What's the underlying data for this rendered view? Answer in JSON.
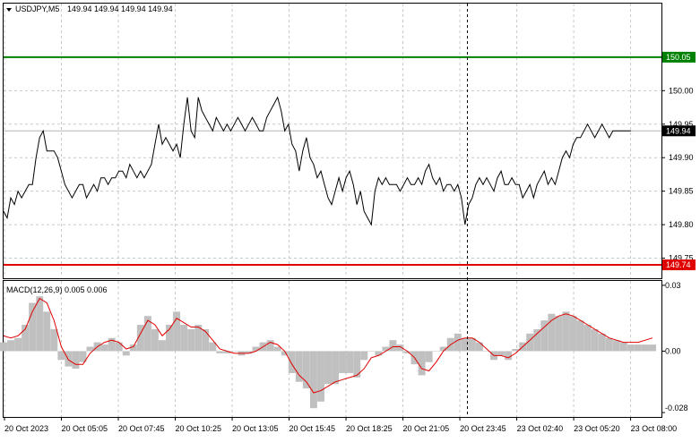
{
  "header": {
    "symbol": "USDJPY,M5",
    "ohlc": "149.94 149.94 149.94 149.94",
    "menu_icon": "triangle-down-icon"
  },
  "colors": {
    "price_line": "#000000",
    "resistance": "#008000",
    "support": "#e00000",
    "macd_hist": "#c0c0c0",
    "macd_signal": "#e00000",
    "grid": "#c8c8c8",
    "current_price_line": "#b4b4b4",
    "current_tag_bg": "#000000"
  },
  "chart_data": [
    {
      "type": "line",
      "name": "price",
      "ylim": [
        149.72,
        150.13
      ],
      "y_ticks": [
        "150.00",
        "149.95",
        "149.90",
        "149.85",
        "149.80",
        "149.75"
      ],
      "x": [
        0,
        2,
        4,
        6,
        8,
        10,
        12,
        14,
        16,
        18,
        20,
        22,
        24,
        26,
        28,
        30,
        32,
        34,
        36,
        38,
        40,
        42,
        44,
        46,
        48,
        50,
        52,
        54,
        56,
        58,
        60,
        62,
        64,
        66,
        68,
        70,
        72,
        74,
        76,
        78,
        80,
        82,
        84,
        86,
        88,
        90,
        92,
        94,
        96,
        98,
        100,
        102,
        104,
        106,
        108,
        110,
        112,
        114,
        116,
        118,
        120,
        122,
        124,
        126,
        128,
        130,
        132,
        134,
        136,
        138,
        140,
        142,
        144,
        146,
        148,
        150,
        152,
        154,
        156,
        158,
        160,
        162,
        164,
        166,
        168,
        170,
        172,
        174,
        176,
        178,
        180,
        182,
        184,
        186,
        188,
        190,
        192,
        194,
        196,
        198,
        200,
        202,
        204,
        206,
        208,
        210,
        212,
        214,
        216,
        218,
        220,
        222,
        224,
        226,
        228,
        230,
        232,
        234,
        236,
        238,
        240,
        242,
        244,
        246,
        248,
        250,
        252,
        254,
        256,
        258,
        260,
        262,
        264,
        266,
        268,
        270,
        272,
        274,
        276,
        278,
        280,
        282,
        284,
        286,
        288,
        290,
        292,
        294,
        296,
        298,
        300,
        302,
        304,
        306,
        308,
        310,
        312,
        314,
        316,
        318,
        320,
        322,
        324,
        326,
        328,
        330,
        332,
        334,
        336,
        338,
        340,
        342,
        344,
        346,
        348,
        350,
        352,
        354,
        356,
        358,
        360
      ],
      "values": [
        149.82,
        149.81,
        149.84,
        149.83,
        149.85,
        149.84,
        149.85,
        149.86,
        149.86,
        149.9,
        149.93,
        149.94,
        149.91,
        149.91,
        149.91,
        149.9,
        149.88,
        149.86,
        149.85,
        149.84,
        149.85,
        149.86,
        149.86,
        149.84,
        149.85,
        149.86,
        149.85,
        149.87,
        149.87,
        149.86,
        149.87,
        149.87,
        149.88,
        149.88,
        149.87,
        149.89,
        149.88,
        149.87,
        149.88,
        149.87,
        149.88,
        149.89,
        149.92,
        149.95,
        149.92,
        149.93,
        149.92,
        149.91,
        149.92,
        149.9,
        149.95,
        149.99,
        149.94,
        149.93,
        149.99,
        149.97,
        149.96,
        149.95,
        149.94,
        149.96,
        149.95,
        149.94,
        149.95,
        149.94,
        149.95,
        149.96,
        149.95,
        149.94,
        149.95,
        149.96,
        149.95,
        149.94,
        149.94,
        149.96,
        149.97,
        149.98,
        149.99,
        149.97,
        149.94,
        149.95,
        149.92,
        149.91,
        149.88,
        149.91,
        149.93,
        149.9,
        149.89,
        149.87,
        149.88,
        149.86,
        149.84,
        149.83,
        149.85,
        149.87,
        149.85,
        149.87,
        149.88,
        149.86,
        149.83,
        149.85,
        149.82,
        149.81,
        149.8,
        149.85,
        149.87,
        149.86,
        149.87,
        149.86,
        149.86,
        149.86,
        149.85,
        149.86,
        149.87,
        149.86,
        149.86,
        149.87,
        149.86,
        149.88,
        149.89,
        149.87,
        149.86,
        149.87,
        149.85,
        149.86,
        149.86,
        149.85,
        149.86,
        149.84,
        149.8,
        149.83,
        149.84,
        149.86,
        149.87,
        149.86,
        149.87,
        149.86,
        149.85,
        149.87,
        149.88,
        149.86,
        149.86,
        149.87,
        149.86,
        149.86,
        149.84,
        149.85,
        149.86,
        149.84,
        149.86,
        149.87,
        149.88,
        149.86,
        149.87,
        149.86,
        149.88,
        149.9,
        149.91,
        149.9,
        149.92,
        149.93,
        149.93,
        149.94,
        149.95,
        149.94,
        149.93,
        149.94,
        149.95,
        149.94,
        149.93,
        149.94,
        149.94,
        149.94,
        149.94,
        149.94,
        149.94
      ],
      "levels": {
        "resistance": 150.05,
        "support": 149.74,
        "current": 149.94
      },
      "level_tags": [
        "150.05",
        "149.74",
        "149.94"
      ]
    },
    {
      "type": "bar",
      "name": "macd",
      "title": "MACD(12,26,9) 0.005 0.006",
      "ylim": [
        -0.03,
        0.032
      ],
      "y_ticks": [
        "0.03",
        "0.00",
        "-0.028"
      ],
      "x": [
        0,
        4,
        8,
        12,
        16,
        20,
        24,
        28,
        32,
        36,
        40,
        44,
        48,
        52,
        56,
        60,
        64,
        68,
        72,
        76,
        80,
        84,
        88,
        92,
        96,
        100,
        104,
        108,
        112,
        116,
        120,
        124,
        128,
        132,
        136,
        140,
        144,
        148,
        152,
        156,
        160,
        164,
        168,
        172,
        176,
        180,
        184,
        188,
        192,
        196,
        200,
        204,
        208,
        212,
        216,
        220,
        224,
        228,
        232,
        236,
        240,
        244,
        248,
        252,
        256,
        260,
        264,
        268,
        272,
        276,
        280,
        284,
        288,
        292,
        296,
        300,
        304,
        308,
        312,
        316,
        320,
        324,
        328,
        332,
        336,
        340,
        344,
        348,
        352,
        356,
        360
      ],
      "histogram": [
        0.004,
        0.005,
        0.006,
        0.012,
        0.022,
        0.025,
        0.018,
        0.01,
        -0.004,
        -0.007,
        -0.008,
        -0.005,
        0.002,
        0.004,
        0.003,
        0.006,
        0.004,
        -0.002,
        0.003,
        0.012,
        0.016,
        0.01,
        0.005,
        0.012,
        0.018,
        0.012,
        0.01,
        0.012,
        0.01,
        0.004,
        -0.001,
        -0.001,
        0.0,
        -0.002,
        -0.001,
        0.002,
        0.004,
        0.005,
        0.002,
        -0.002,
        -0.01,
        -0.014,
        -0.017,
        -0.026,
        -0.023,
        -0.015,
        -0.015,
        -0.01,
        -0.01,
        -0.012,
        -0.004,
        0.0,
        -0.002,
        0.002,
        0.005,
        0.003,
        -0.001,
        -0.006,
        -0.011,
        -0.005,
        0.0,
        0.002,
        0.006,
        0.008,
        0.006,
        0.006,
        0.004,
        0.0,
        -0.004,
        -0.002,
        -0.004,
        0.001,
        0.004,
        0.008,
        0.01,
        0.014,
        0.017,
        0.016,
        0.018,
        0.016,
        0.014,
        0.012,
        0.01,
        0.008,
        0.006,
        0.005,
        0.004,
        0.003,
        0.003,
        0.003,
        0.003
      ],
      "signal": [
        0.007,
        0.006,
        0.007,
        0.01,
        0.018,
        0.024,
        0.022,
        0.014,
        0.002,
        -0.004,
        -0.006,
        -0.006,
        -0.001,
        0.002,
        0.004,
        0.005,
        0.004,
        0.001,
        0.002,
        0.008,
        0.014,
        0.012,
        0.007,
        0.01,
        0.015,
        0.013,
        0.011,
        0.011,
        0.009,
        0.005,
        0.001,
        0.0,
        -0.001,
        -0.001,
        -0.001,
        0.0,
        0.002,
        0.004,
        0.003,
        0.0,
        -0.006,
        -0.011,
        -0.014,
        -0.019,
        -0.018,
        -0.016,
        -0.014,
        -0.013,
        -0.012,
        -0.011,
        -0.008,
        -0.003,
        -0.002,
        0.0,
        0.002,
        0.002,
        0.0,
        -0.003,
        -0.008,
        -0.009,
        -0.005,
        0.0,
        0.003,
        0.005,
        0.006,
        0.006,
        0.004,
        0.001,
        -0.002,
        -0.002,
        -0.003,
        -0.001,
        0.002,
        0.005,
        0.008,
        0.011,
        0.014,
        0.016,
        0.017,
        0.016,
        0.014,
        0.012,
        0.01,
        0.008,
        0.006,
        0.005,
        0.004,
        0.004,
        0.004,
        0.005,
        0.006
      ]
    }
  ],
  "x_axis_labels": [
    "20 Oct 2023",
    "20 Oct 05:05",
    "20 Oct 07:45",
    "20 Oct 10:25",
    "20 Oct 13:05",
    "20 Oct 15:45",
    "20 Oct 18:25",
    "20 Oct 21:05",
    "20 Oct 23:45",
    "23 Oct 02:40",
    "23 Oct 05:20",
    "23 Oct 08:00"
  ]
}
